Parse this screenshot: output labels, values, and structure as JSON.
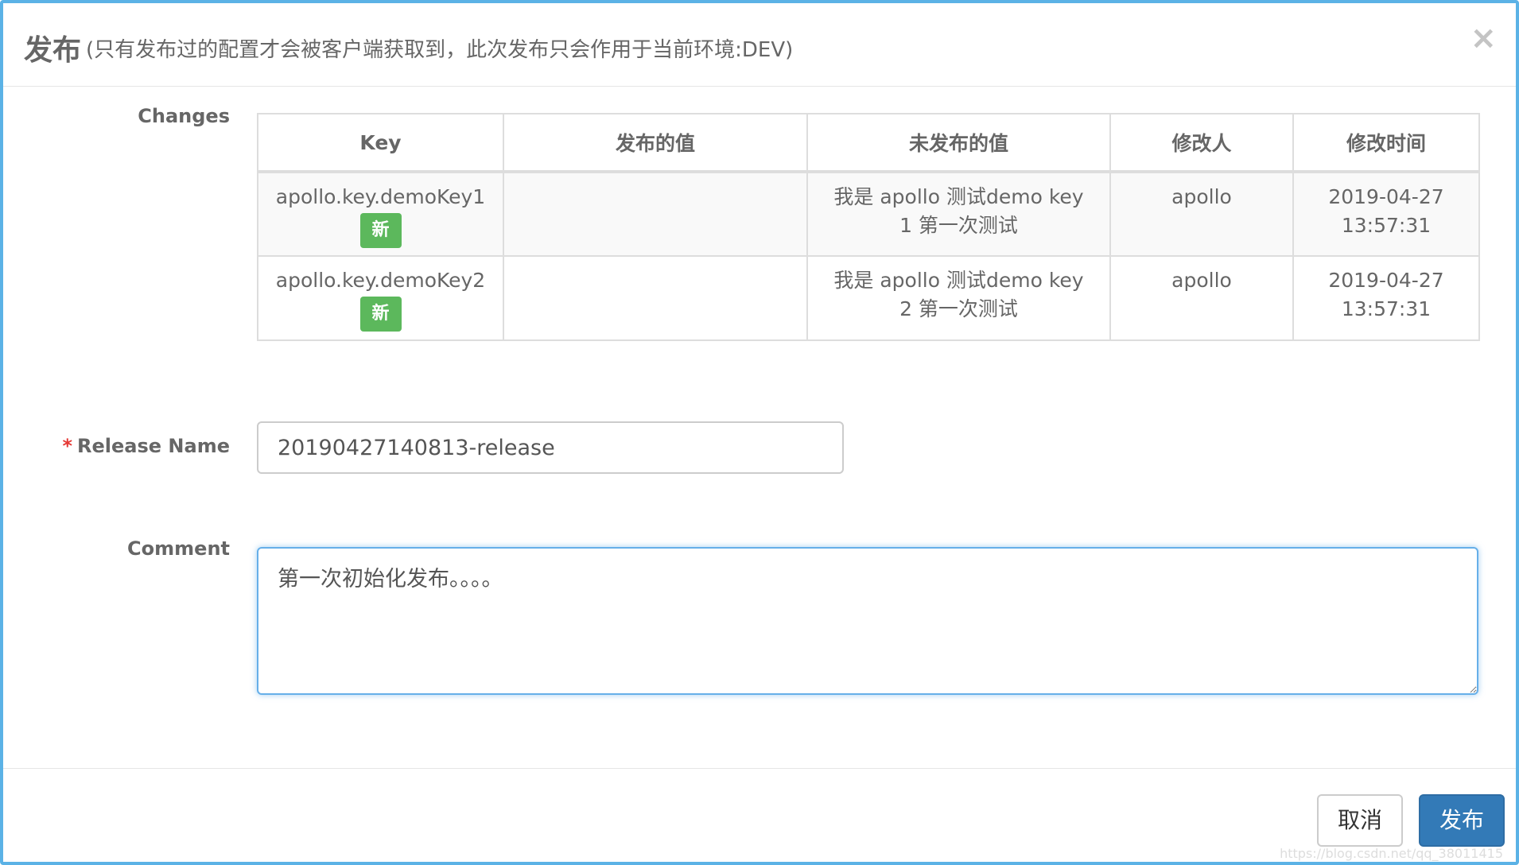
{
  "dialog": {
    "title": "发布",
    "subtitle": "(只有发布过的配置才会被客户端获取到，此次发布只会作用于当前环境:DEV)",
    "close_glyph": "×"
  },
  "changes": {
    "label": "Changes",
    "columns": [
      "Key",
      "发布的值",
      "未发布的值",
      "修改人",
      "修改时间"
    ],
    "rows": [
      {
        "key": "apollo.key.demoKey1",
        "badge": "新",
        "released_value": "",
        "unreleased_value": "我是 apollo 测试demo key 1 第一次测试",
        "modifier": "apollo",
        "modified_time": "2019-04-27 13:57:31"
      },
      {
        "key": "apollo.key.demoKey2",
        "badge": "新",
        "released_value": "",
        "unreleased_value": "我是 apollo 测试demo key 2 第一次测试",
        "modifier": "apollo",
        "modified_time": "2019-04-27 13:57:31"
      }
    ]
  },
  "release_name": {
    "required_mark": "*",
    "label": "Release Name",
    "value": "20190427140813-release"
  },
  "comment": {
    "label": "Comment",
    "value": "第一次初始化发布。。。。"
  },
  "footer": {
    "cancel_label": "取消",
    "release_label": "发布"
  },
  "watermark": "https://blog.csdn.net/qq_38011415",
  "colors": {
    "frame_border": "#5bb2e6",
    "primary": "#337ab7",
    "badge_green": "#5cb85c",
    "required_red": "#e53935"
  },
  "icons": {
    "close": "close-icon"
  }
}
